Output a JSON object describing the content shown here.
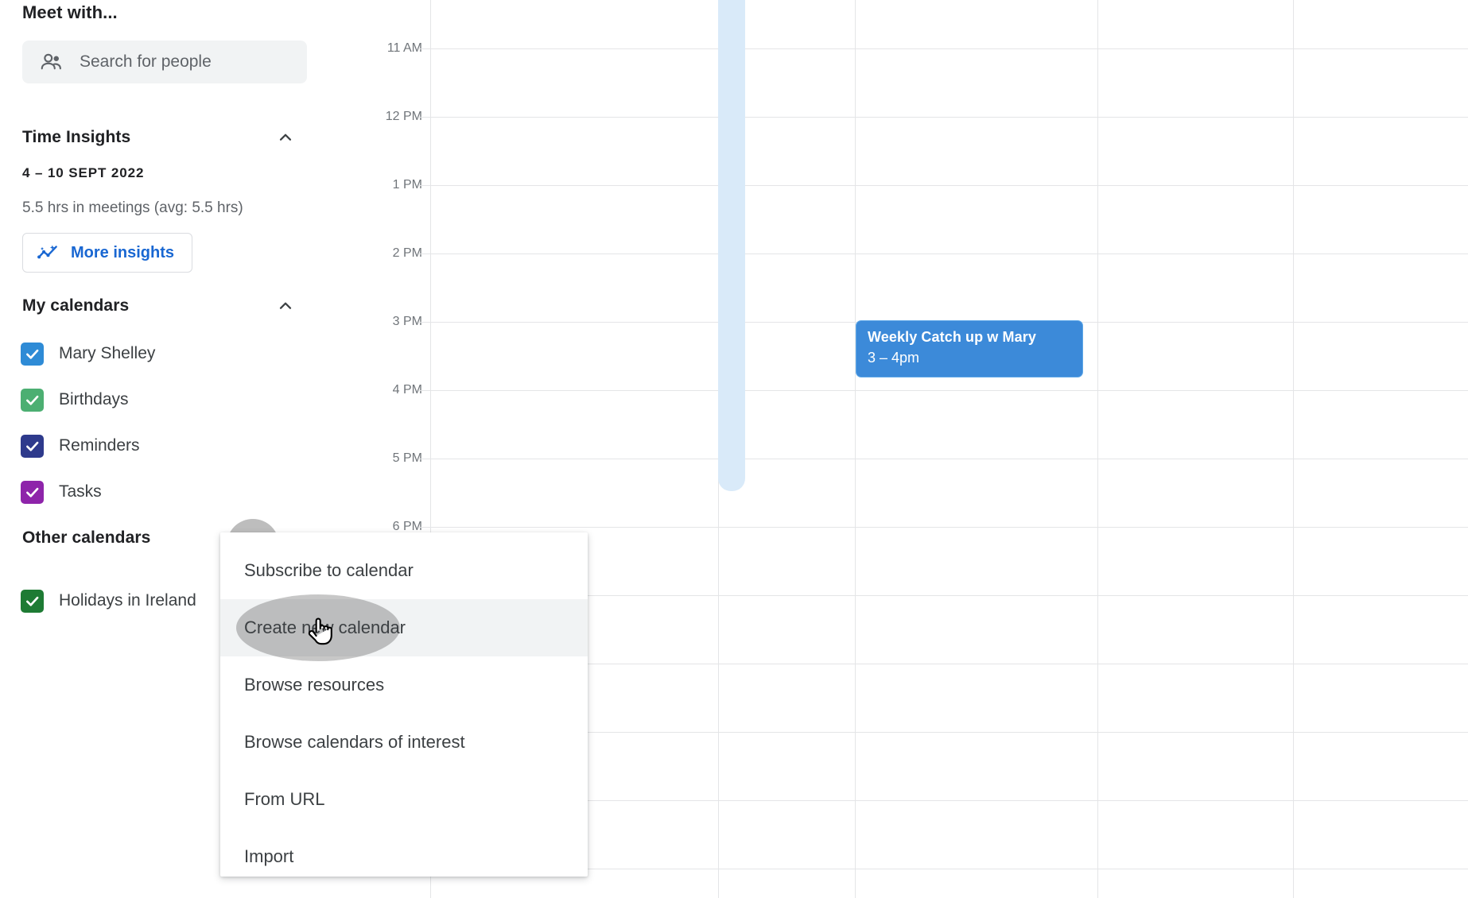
{
  "sidebar": {
    "meet_with_title": "Meet with...",
    "search": {
      "placeholder": "Search for people",
      "icon": "people-icon"
    },
    "time_insights": {
      "title": "Time Insights",
      "collapse_icon": "chevron-up-icon",
      "date_range": "4 – 10 SEPT 2022",
      "summary": "5.5 hrs in meetings (avg: 5.5 hrs)",
      "more_insights_label": "More insights",
      "more_insights_icon": "insights-sparkline-icon",
      "accent_color": "#1967d2"
    },
    "my_calendars": {
      "title": "My calendars",
      "collapse_icon": "chevron-up-icon",
      "items": [
        {
          "label": "Mary Shelley",
          "color": "#2e8bd6",
          "checked": true
        },
        {
          "label": "Birthdays",
          "color": "#4caf72",
          "checked": true
        },
        {
          "label": "Reminders",
          "color": "#2e3a8c",
          "checked": true
        },
        {
          "label": "Tasks",
          "color": "#8e24aa",
          "checked": true
        }
      ]
    },
    "other_calendars": {
      "title": "Other calendars",
      "items": [
        {
          "label": "Holidays in Ireland",
          "color": "#1e7b34",
          "checked": true
        }
      ]
    }
  },
  "menu": {
    "items": [
      {
        "label": "Subscribe to calendar",
        "hovered": false
      },
      {
        "label": "Create new calendar",
        "hovered": true
      },
      {
        "label": "Browse resources",
        "hovered": false
      },
      {
        "label": "Browse calendars of interest",
        "hovered": false
      },
      {
        "label": "From URL",
        "hovered": false
      },
      {
        "label": "Import",
        "hovered": false
      }
    ]
  },
  "calendar": {
    "hours": [
      "11 AM",
      "12 PM",
      "1 PM",
      "2 PM",
      "3 PM",
      "4 PM",
      "5 PM",
      "6 PM"
    ],
    "current_time_indicator_color": "#d9eaf9",
    "events": [
      {
        "title": "Weekly Catch up w Mary",
        "time": "3 – 4pm",
        "color": "#3c8ad9"
      }
    ]
  },
  "cursor": {
    "icon": "pointing-hand-cursor"
  }
}
